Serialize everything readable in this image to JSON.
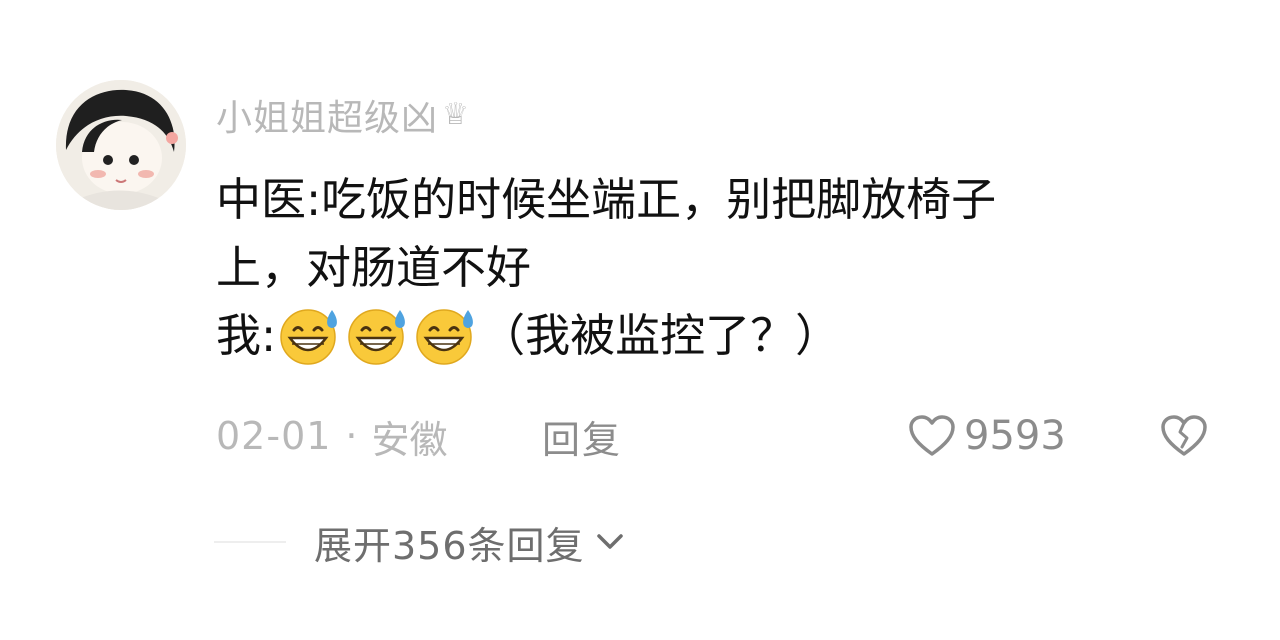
{
  "comment": {
    "username": "小姐姐超级凶",
    "badge_icon": "crown-icon",
    "text_line1": "中医:吃饭的时候坐端正，别把脚放椅子",
    "text_line2": "上，对肠道不好",
    "text_line3_prefix": "我:",
    "emoji_icon": "grinning-sweat-emoji",
    "emoji_count": 3,
    "text_line3_suffix": "（我被监控了？）",
    "date": "02-01",
    "separator": "·",
    "location": "安徽",
    "reply_label": "回复",
    "like_icon": "heart-outline-icon",
    "like_count": "9593",
    "dislike_icon": "broken-heart-icon"
  },
  "replies": {
    "expand_label": "展开356条回复",
    "expand_icon": "chevron-down-icon"
  },
  "colors": {
    "primary_text": "#111111",
    "muted_text": "#b8b8b8",
    "action_text": "#8c8c8c",
    "expand_text": "#6e6e6e",
    "emoji_yellow": "#f9c93a",
    "emoji_sweat": "#4fa3e0"
  }
}
